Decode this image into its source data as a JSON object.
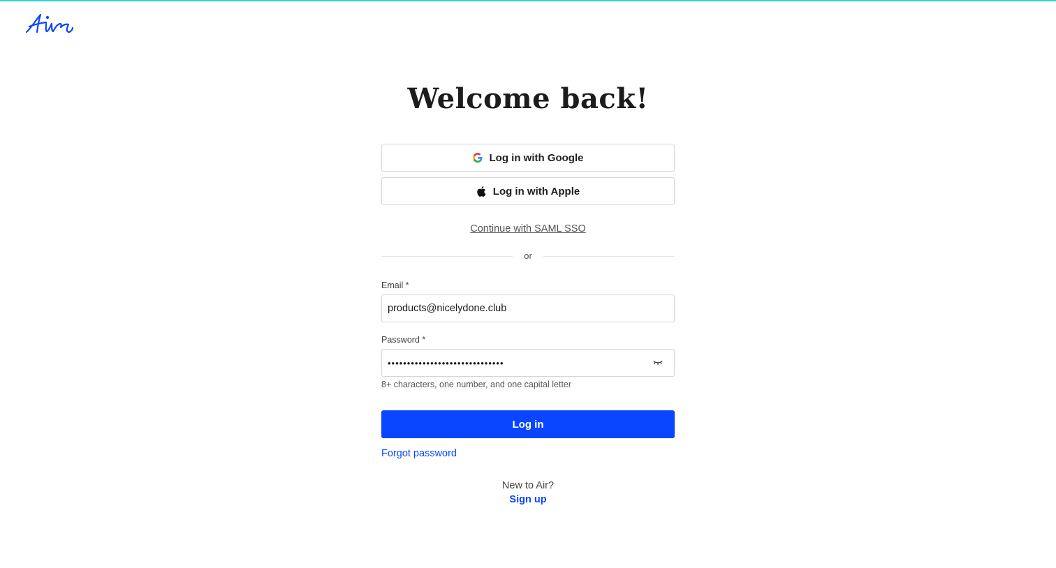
{
  "brand": {
    "logo_icon": "air-logo-icon",
    "accent_color": "#2ad4d9",
    "primary_color": "#0a46ff"
  },
  "main": {
    "title": "Welcome back!",
    "google_button_label": "Log in with Google",
    "apple_button_label": "Log in with Apple",
    "saml_link": "Continue with SAML SSO",
    "divider_text": "or",
    "email": {
      "label": "Email *",
      "value": "products@nicelydone.club"
    },
    "password": {
      "label": "Password *",
      "value": "••••••••••••••••••••••••••••••",
      "hint": "8+ characters, one number, and one capital letter",
      "toggle_icon": "eye-closed-icon"
    },
    "login_button_label": "Log in",
    "forgot_password": "Forgot password",
    "new_prompt": "New to Air?",
    "signup_link": "Sign up"
  }
}
